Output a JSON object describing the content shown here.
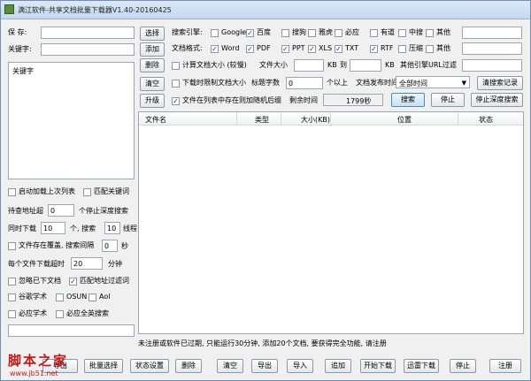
{
  "app": {
    "title": "满江软件-共享文档批量下载器V1.40-20160425"
  },
  "left": {
    "save_label": "保  存:",
    "save_value": "",
    "keyword_label": "关键字:",
    "keyword_value": "",
    "list_header": "关键字",
    "options": {
      "auto_load": "启动加载上次列表",
      "match_keyword": "匹配关键词",
      "wait_prefix": "待查地址超",
      "wait_value": "0",
      "wait_suffix": "个停止深度搜索",
      "sim_prefix": "同时下载",
      "sim_value": "10",
      "sim_mid": "个, 搜索",
      "sim_value2": "10",
      "sim_suffix": "线程",
      "exists_label": "文件存在覆盖, 搜索间隔",
      "exists_value": "0",
      "exists_suffix": "秒",
      "timeout_prefix": "每个文件下载超时",
      "timeout_value": "20",
      "timeout_suffix": "分钟",
      "ignore_downloaded": "忽略已下文档",
      "match_address": "匹配地址过滤词",
      "google_scholar": "谷歌学术",
      "osun": "OSUN",
      "aol": "Aol",
      "bidu_scholar": "必应学术",
      "bing_all": "必应全英搜索"
    }
  },
  "top": {
    "choose_btn": "选择",
    "add_btn": "添加",
    "delete_btn": "删除",
    "clear_btn": "清空",
    "upgrade_btn": "升级",
    "engine_label": "搜索引擎:",
    "engines": [
      "Google",
      "百度",
      "搜狗",
      "雅虎",
      "必应",
      "有道",
      "中搜",
      "其他"
    ],
    "engines_checked": [
      false,
      true,
      false,
      false,
      false,
      false,
      false,
      false
    ],
    "format_label": "文档格式:",
    "formats": [
      "Word",
      "PDF",
      "PPT",
      "XLS",
      "TXT",
      "RTF",
      "压缩",
      "其他"
    ],
    "formats_checked": [
      true,
      true,
      true,
      true,
      true,
      true,
      false,
      false
    ],
    "calc_size_label": "计算文档大小 (较慢)",
    "file_size_label": "文件大小",
    "kb1": "KB",
    "to": "到",
    "kb2": "KB",
    "other_filter": "其他引擎URL过滤",
    "limit_size_label": "下载时限制文档大小",
    "title_chars_label": "标题字数",
    "title_chars_value": "0",
    "above": "个以上",
    "publish_time_label": "文档发布时间:",
    "publish_time_value": "全部时间",
    "clear_record_btn": "清搜索记录",
    "random_name_label": "文件在列表中存在则加随机后缀",
    "remaining_label": "剩余时间",
    "remaining_value": "1799秒",
    "search_btn": "搜索",
    "stop_btn": "停止",
    "stop_deep_btn": "停止深度搜索"
  },
  "table": {
    "columns": [
      "文件名",
      "类型",
      "大小(KB)",
      "位置",
      "状态"
    ]
  },
  "status_text": "未注册或软件已过期, 只能运行30分钟, 添加20个文档, 要获得完全功能, 请注册",
  "bottom_buttons": [
    "导出",
    "批量选择",
    "状态设置",
    "删除",
    "清空",
    "导出",
    "导入",
    "追加",
    "开始下载",
    "迅雷下载",
    "停止",
    "注册"
  ],
  "watermark": {
    "brand": "脚本之家",
    "url": "www.jb51.net"
  }
}
